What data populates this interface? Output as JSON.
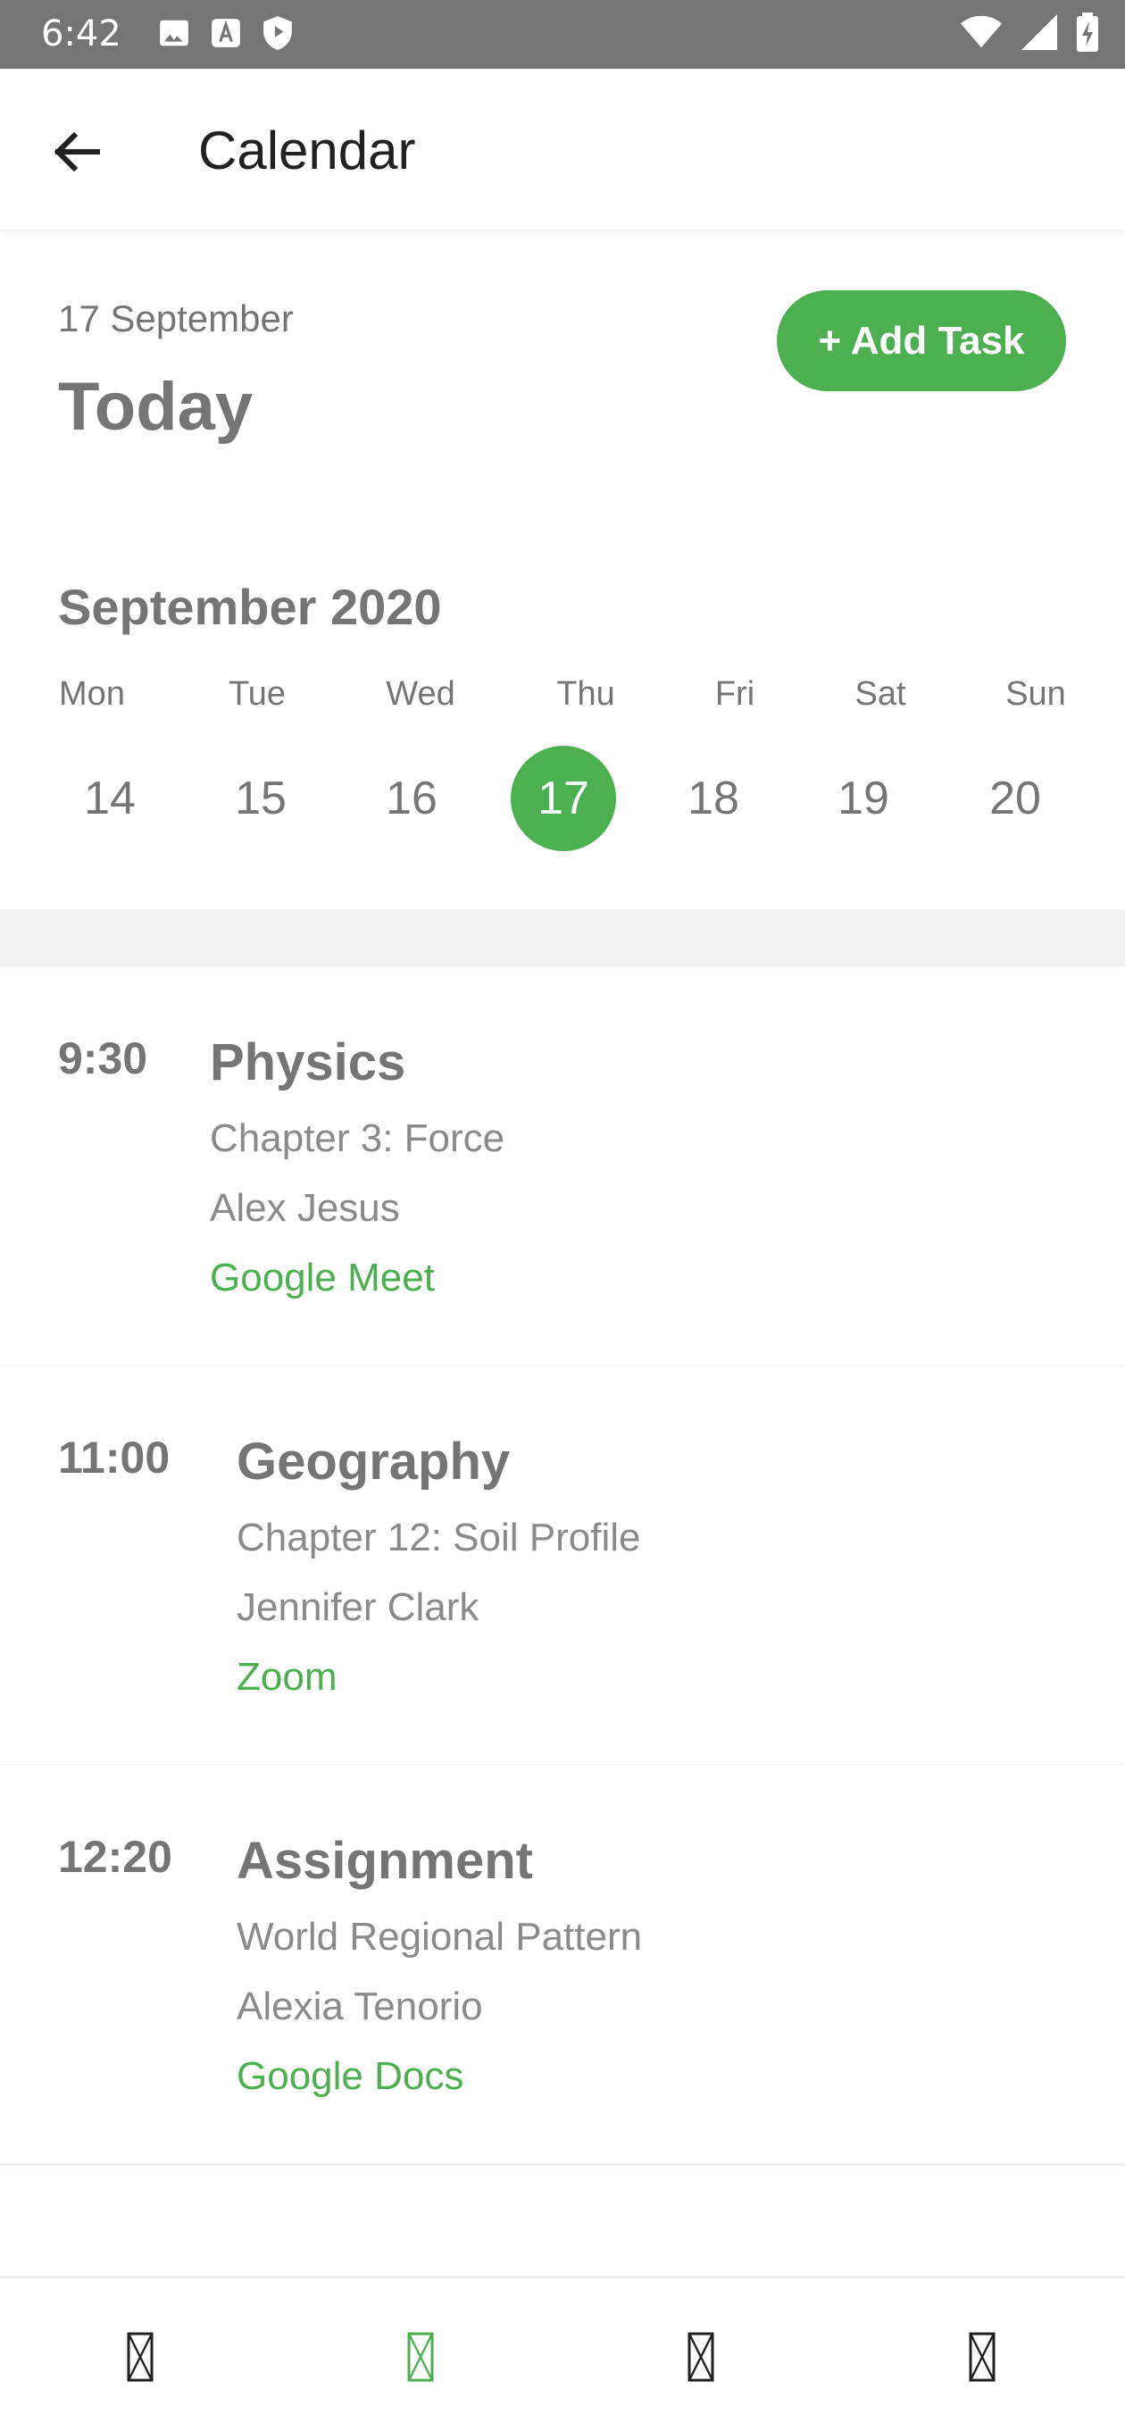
{
  "status_bar": {
    "time": "6:42",
    "left_icons": [
      "image-icon",
      "text-a-icon",
      "shield-play-icon"
    ],
    "right_icons": [
      "wifi-icon",
      "signal-icon",
      "battery-charging-icon"
    ]
  },
  "app_bar": {
    "title": "Calendar",
    "back_icon": "arrow-left-icon"
  },
  "header": {
    "date": "17 September",
    "title": "Today",
    "add_task_label": "+ Add Task"
  },
  "calendar": {
    "month": "September 2020",
    "weekdays": [
      "Mon",
      "Tue",
      "Wed",
      "Thu",
      "Fri",
      "Sat",
      "Sun"
    ],
    "days": [
      "14",
      "15",
      "16",
      "17",
      "18",
      "19",
      "20"
    ],
    "selected_day": "17"
  },
  "events": [
    {
      "time": "9:30",
      "title": "Physics",
      "chapter": "Chapter 3: Force",
      "teacher": "Alex Jesus",
      "platform": "Google Meet"
    },
    {
      "time": "11:00",
      "title": "Geography",
      "chapter": "Chapter 12: Soil Profile",
      "teacher": "Jennifer Clark",
      "platform": "Zoom"
    },
    {
      "time": "12:20",
      "title": "Assignment",
      "chapter": "World Regional Pattern",
      "teacher": "Alexia Tenorio",
      "platform": "Google Docs"
    }
  ],
  "bottom_nav": {
    "items": [
      "nav-icon-1",
      "nav-icon-2",
      "nav-icon-3",
      "nav-icon-4"
    ],
    "active_index": 1
  },
  "colors": {
    "accent": "#4CAF50",
    "text_gray": "#757575",
    "status_bar": "#757575"
  }
}
